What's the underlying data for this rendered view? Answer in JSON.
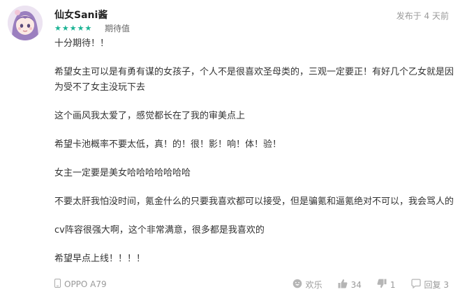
{
  "review": {
    "username": "仙女Sani酱",
    "stars": "★★★★★",
    "rating_label": "期待值",
    "posted": "发布于 4 天前",
    "paragraphs": [
      "十分期待！！",
      "希望女主可以是有勇有谋的女孩子，个人不是很喜欢圣母类的，三观一定要正！有好几个乙女就是因为受不了女主没玩下去",
      "这个画风我太爱了，感觉都长在了我的审美点上",
      "希望卡池概率不要太低，真！的！很！影！响！体！验！",
      "女主一定要是美女哈哈哈哈哈哈哈",
      "不要太肝我怕没时间，氪金什么的只要我喜欢都可以接受，但是骗氪和逼氪绝对不可以，我会骂人的",
      "cv阵容很强大啊，这个非常满意，很多都是我喜欢的",
      "希望早点上线！！！！"
    ],
    "device": "OPPO A79",
    "actions": {
      "fun": "欢乐",
      "likes": "34",
      "dislikes": "1",
      "reply": "回复 3"
    }
  },
  "colors": {
    "accent": "#1ab394",
    "meta": "#9a9a9a",
    "text": "#333333"
  },
  "icons": [
    "avatar-anime-girl",
    "phone-icon",
    "laugh-face-icon",
    "thumbs-up-icon",
    "thumbs-down-icon",
    "chat-bubble-icon"
  ]
}
